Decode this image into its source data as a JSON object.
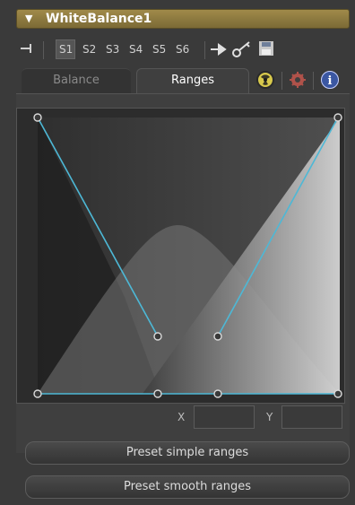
{
  "header": {
    "title": "WhiteBalance1"
  },
  "toolbar": {
    "slots": [
      "S1",
      "S2",
      "S3",
      "S4",
      "S5",
      "S6"
    ],
    "selected_slot": "S1"
  },
  "tabs": [
    {
      "label": "Balance",
      "active": false
    },
    {
      "label": "Ranges",
      "active": true
    }
  ],
  "tab_icons": [
    "radiation-icon",
    "gear-icon",
    "info-icon"
  ],
  "coords": {
    "x_label": "X",
    "y_label": "Y",
    "x_value": "",
    "y_value": ""
  },
  "buttons": {
    "preset_simple": "Preset simple ranges",
    "preset_smooth": "Preset smooth ranges"
  },
  "colors": {
    "title_bar": "#8f7b40",
    "curve_line": "#4db8d6"
  }
}
